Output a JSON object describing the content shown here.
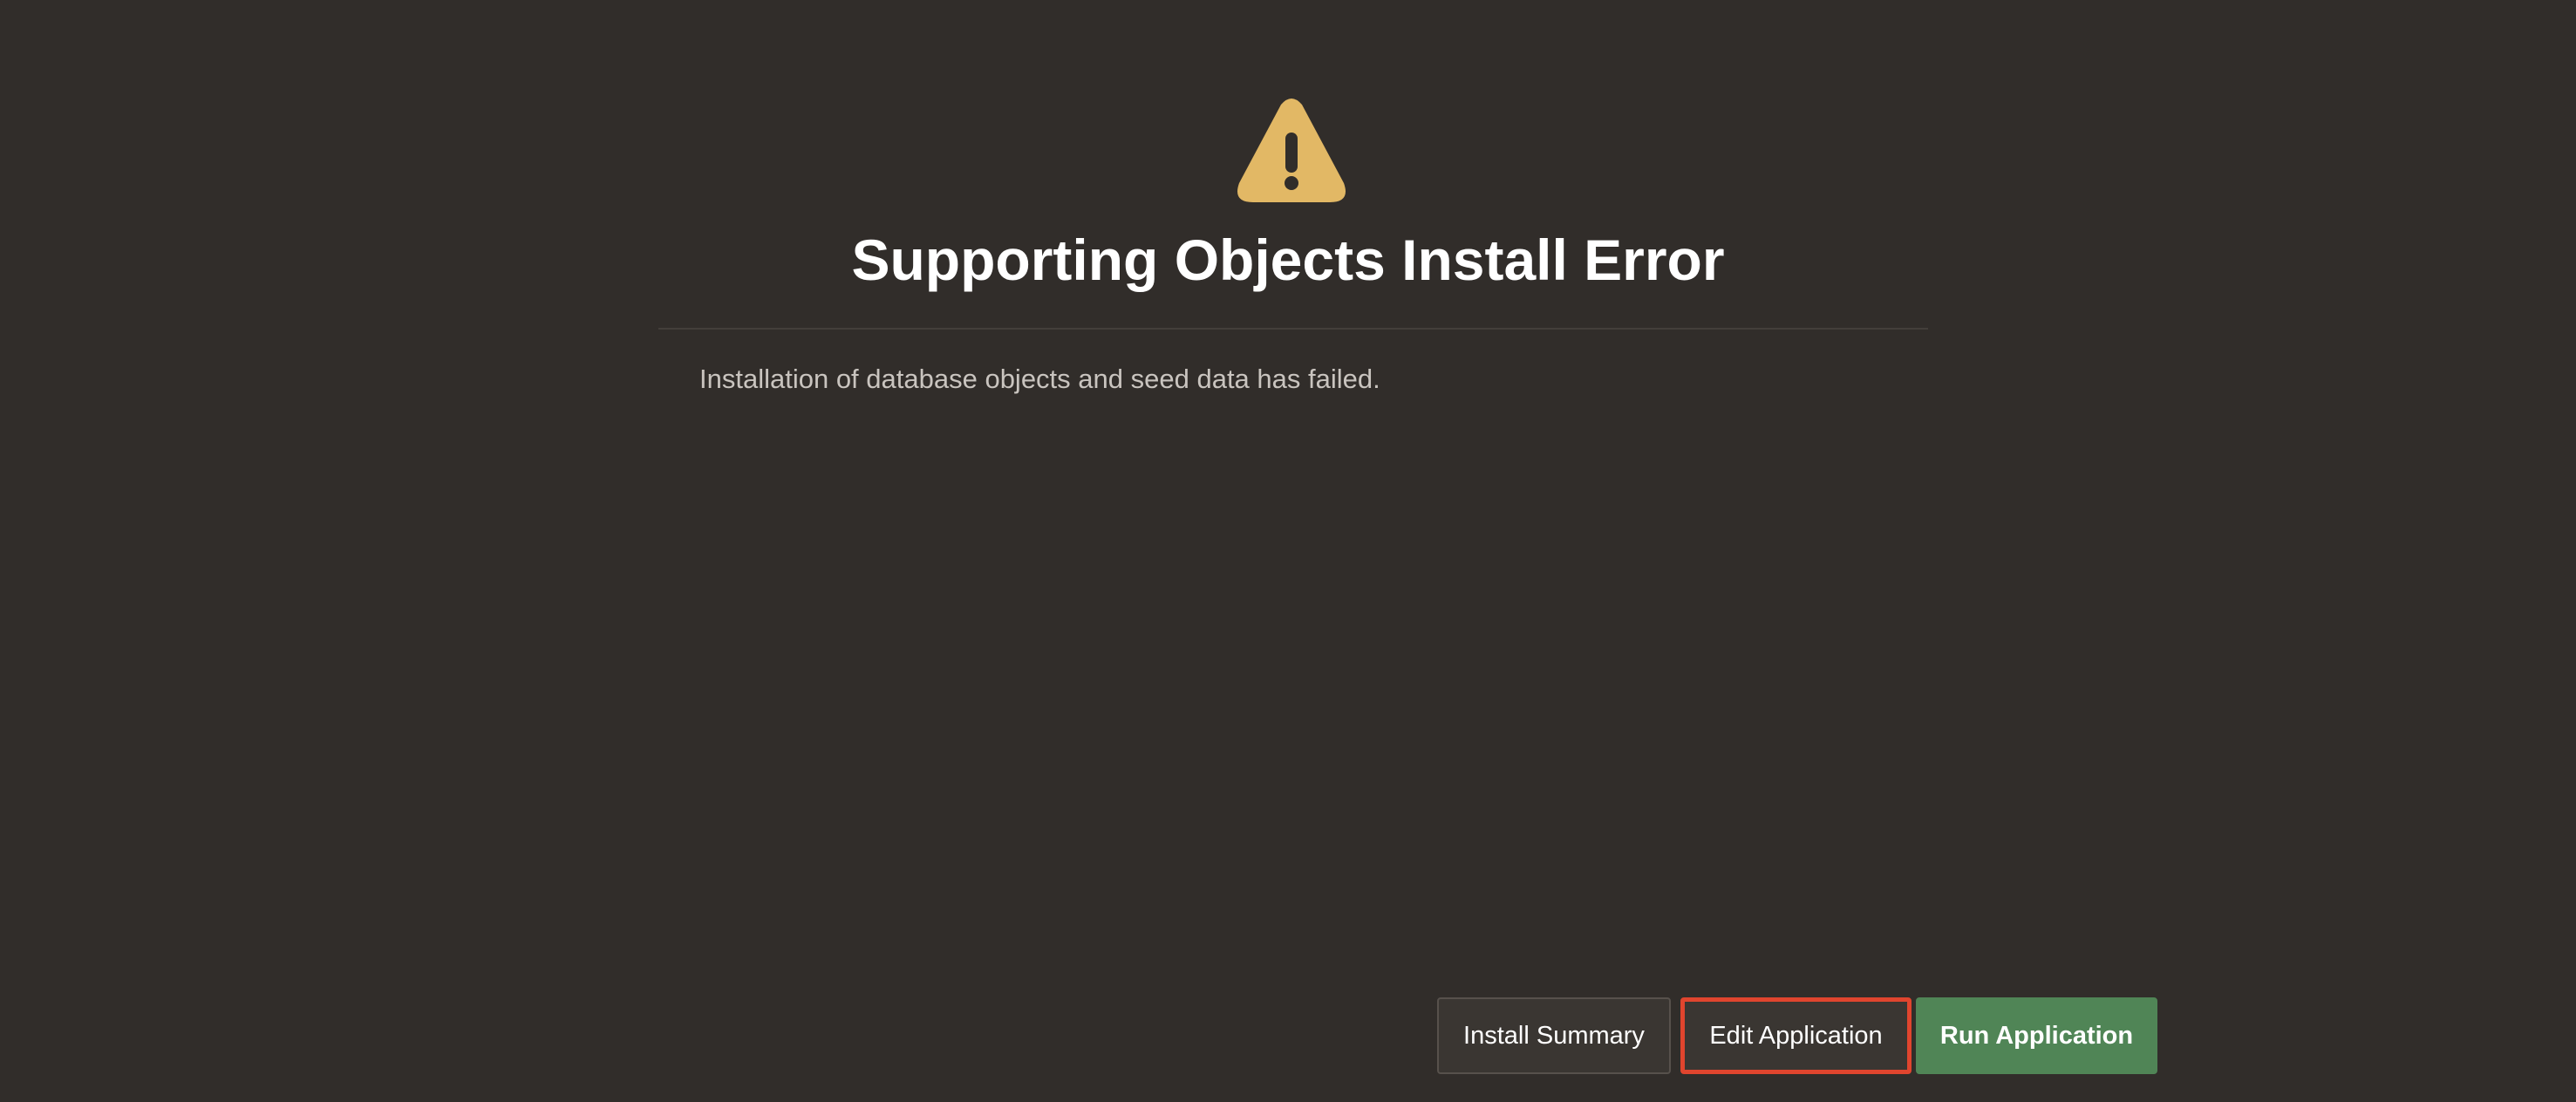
{
  "dialog": {
    "icon": "warning-triangle-icon",
    "title": "Supporting Objects Install Error",
    "message": "Installation of database objects and seed data has failed."
  },
  "buttons": {
    "install_summary": "Install Summary",
    "edit_application": "Edit Application",
    "run_application": "Run Application"
  },
  "colors": {
    "background": "#312d2a",
    "warning": "#e2b865",
    "primary_button": "#508556",
    "highlight_border": "#e0452e"
  }
}
